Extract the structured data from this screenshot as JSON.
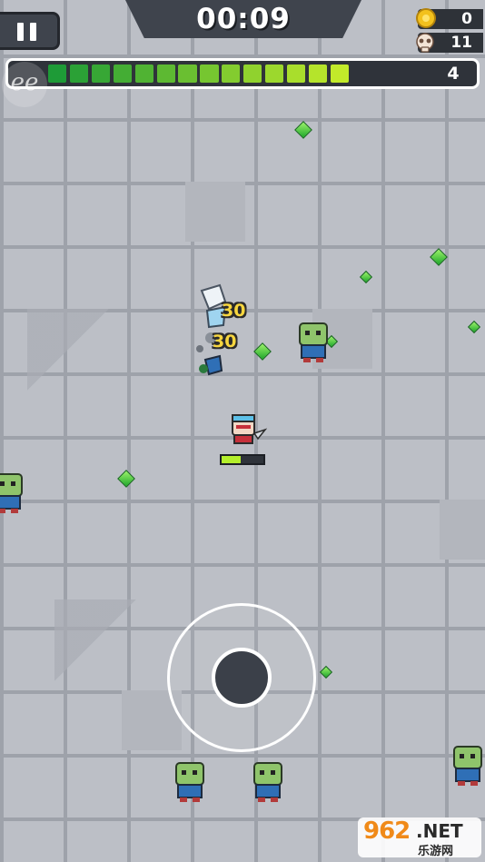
{
  "hud": {
    "timer": "00:09",
    "coins": "0",
    "kills": "11",
    "level": "4",
    "xp_progress": 0.78,
    "xp_segments_total": 18,
    "colors": {
      "panel": "#3f444d",
      "xp_dark": "#1e9b37",
      "xp_light": "#c2ea2a"
    }
  },
  "logo_text": "ee",
  "damage_numbers": [
    "30",
    "30"
  ],
  "player": {
    "hp_fraction": 0.45
  },
  "watermark": {
    "number": "962",
    "suffix": ".NET",
    "chinese": "乐游网"
  },
  "icons": [
    "pause-icon",
    "coin-icon",
    "skull-icon",
    "gem-icon",
    "zombie-icon",
    "hero-icon",
    "slash-effect-icon"
  ]
}
